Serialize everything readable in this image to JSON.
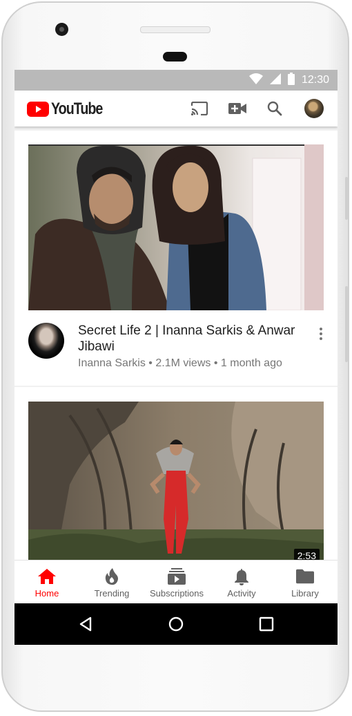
{
  "status_bar": {
    "time": "12:30",
    "icons": [
      "wifi-icon",
      "cellular-signal-icon",
      "battery-icon"
    ]
  },
  "app_bar": {
    "app_name": "YouTube",
    "actions": [
      "cast-icon",
      "upload-video-icon",
      "search-icon",
      "account-avatar"
    ]
  },
  "feed": {
    "videos": [
      {
        "title": "Secret Life 2 | Inanna Sarkis & Anwar Jibawi",
        "channel": "Inanna Sarkis",
        "views": "2.1M views",
        "age": "1 month ago",
        "separator": "•",
        "duration": ""
      },
      {
        "title": "",
        "channel": "",
        "views": "",
        "age": "",
        "duration": "2:53"
      }
    ]
  },
  "bottom_nav": {
    "items": [
      {
        "label": "Home",
        "icon": "home-icon",
        "active": true
      },
      {
        "label": "Trending",
        "icon": "flame-icon",
        "active": false
      },
      {
        "label": "Subscriptions",
        "icon": "subscriptions-icon",
        "active": false
      },
      {
        "label": "Activity",
        "icon": "bell-icon",
        "active": false
      },
      {
        "label": "Library",
        "icon": "folder-icon",
        "active": false
      }
    ]
  },
  "system_nav": [
    "back-icon",
    "home-circle-icon",
    "recents-icon"
  ],
  "colors": {
    "brand_red": "#ff0000",
    "status_bar": "#b9b9b9",
    "text_primary": "#212121",
    "text_secondary": "#767676"
  }
}
